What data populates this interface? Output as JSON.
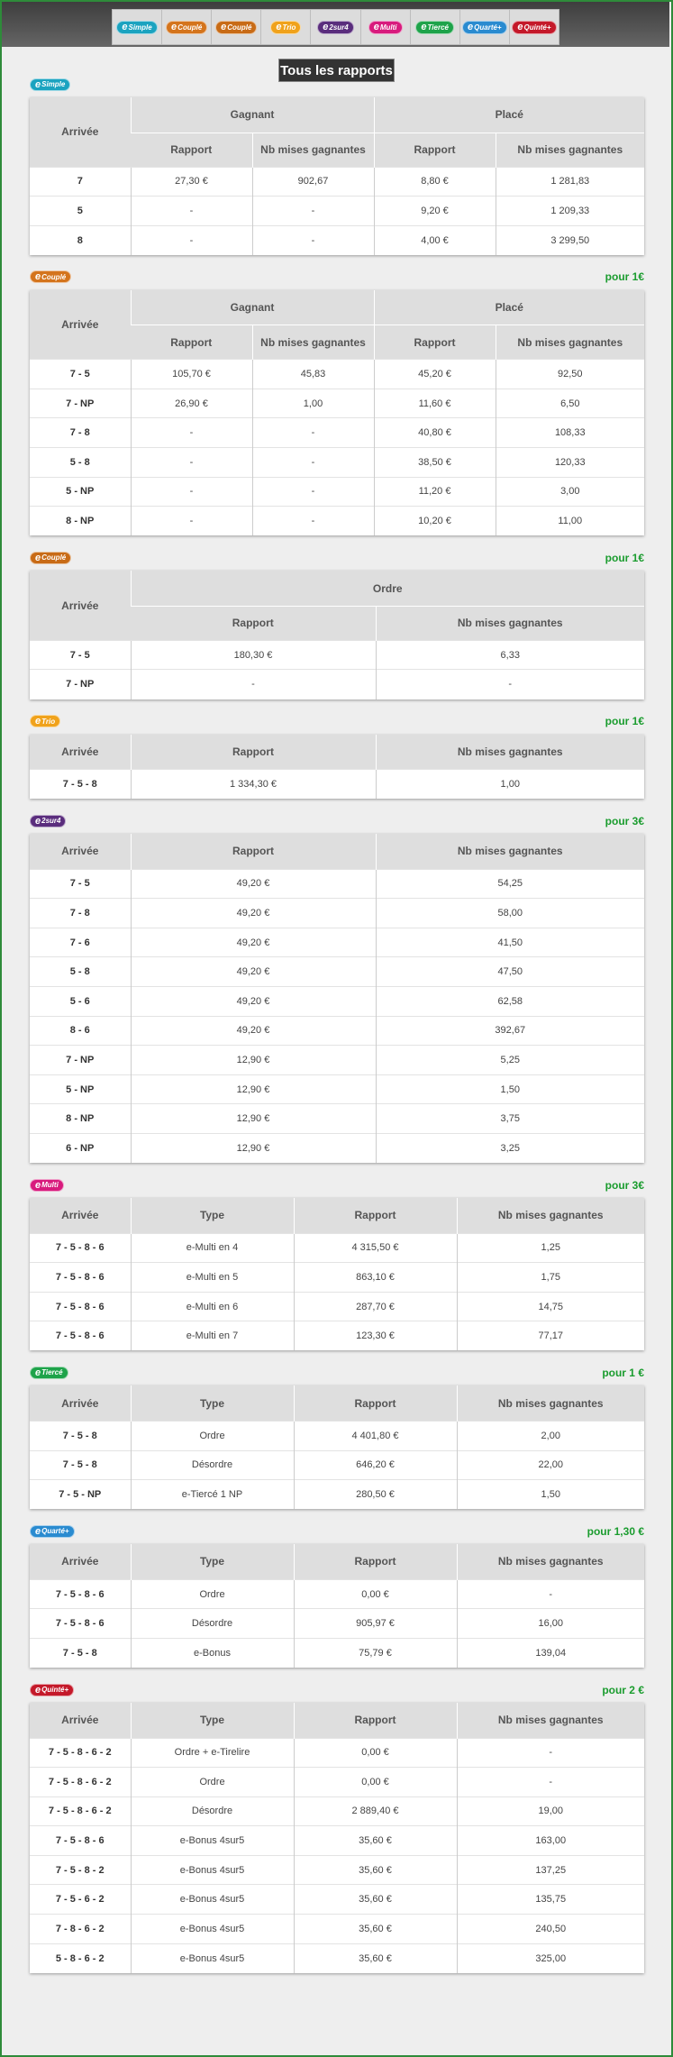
{
  "title": "Tous les rapports",
  "bet_types": [
    {
      "label": "Simple",
      "color": "#1ba3c0",
      "icon": "e-simple-logo"
    },
    {
      "label": "Couplé",
      "color": "#d4741c",
      "icon": "e-couple-logo"
    },
    {
      "label": "Couplé",
      "color": "#c86b16",
      "icon": "e-couple-ordre-logo"
    },
    {
      "label": "Trio",
      "color": "#f0a21b",
      "icon": "e-trio-logo"
    },
    {
      "label": "2sur4",
      "color": "#5a2d7d",
      "icon": "e-2sur4-logo"
    },
    {
      "label": "Multi",
      "color": "#d81b7d",
      "icon": "e-multi-logo"
    },
    {
      "label": "Tiercé",
      "color": "#1ea34a",
      "icon": "e-tierce-logo"
    },
    {
      "label": "Quarté+",
      "color": "#2a8bd0",
      "icon": "e-quarte-logo"
    },
    {
      "label": "Quinté+",
      "color": "#c4192a",
      "icon": "e-quinte-logo"
    }
  ],
  "sections": [
    {
      "bet": "Simple",
      "color": "#1ba3c0",
      "unit": "",
      "layout": "grouped",
      "groups": [
        "Gagnant",
        "Placé"
      ],
      "headers": [
        "Arrivée",
        "Rapport",
        "Nb mises gagnantes",
        "Rapport",
        "Nb mises gagnantes"
      ],
      "rows": [
        [
          "7",
          "27,30 €",
          "902,67",
          "8,80 €",
          "1 281,83"
        ],
        [
          "5",
          "-",
          "-",
          "9,20 €",
          "1 209,33"
        ],
        [
          "8",
          "-",
          "-",
          "4,00 €",
          "3 299,50"
        ]
      ]
    },
    {
      "bet": "Couplé",
      "color": "#d4741c",
      "unit": "pour 1€",
      "layout": "grouped",
      "groups": [
        "Gagnant",
        "Placé"
      ],
      "headers": [
        "Arrivée",
        "Rapport",
        "Nb mises gagnantes",
        "Rapport",
        "Nb mises gagnantes"
      ],
      "rows": [
        [
          "7 - 5",
          "105,70 €",
          "45,83",
          "45,20 €",
          "92,50"
        ],
        [
          "7 - NP",
          "26,90 €",
          "1,00",
          "11,60 €",
          "6,50"
        ],
        [
          "7 - 8",
          "-",
          "-",
          "40,80 €",
          "108,33"
        ],
        [
          "5 - 8",
          "-",
          "-",
          "38,50 €",
          "120,33"
        ],
        [
          "5 - NP",
          "-",
          "-",
          "11,20 €",
          "3,00"
        ],
        [
          "8 - NP",
          "-",
          "-",
          "10,20 €",
          "11,00"
        ]
      ]
    },
    {
      "bet": "Couplé",
      "color": "#c86b16",
      "unit": "pour 1€",
      "layout": "grouped",
      "groups": [
        "Ordre"
      ],
      "headers": [
        "Arrivée",
        "Rapport",
        "Nb mises gagnantes"
      ],
      "rows": [
        [
          "7 - 5",
          "180,30 €",
          "6,33"
        ],
        [
          "7 - NP",
          "-",
          "-"
        ]
      ]
    },
    {
      "bet": "Trio",
      "color": "#f0a21b",
      "unit": "pour 1€",
      "layout": "simple",
      "headers": [
        "Arrivée",
        "Rapport",
        "Nb mises gagnantes"
      ],
      "rows": [
        [
          "7 - 5 - 8",
          "1 334,30 €",
          "1,00"
        ]
      ]
    },
    {
      "bet": "2sur4",
      "color": "#5a2d7d",
      "unit": "pour 3€",
      "layout": "simple",
      "headers": [
        "Arrivée",
        "Rapport",
        "Nb mises gagnantes"
      ],
      "rows": [
        [
          "7 - 5",
          "49,20 €",
          "54,25"
        ],
        [
          "7 - 8",
          "49,20 €",
          "58,00"
        ],
        [
          "7 - 6",
          "49,20 €",
          "41,50"
        ],
        [
          "5 - 8",
          "49,20 €",
          "47,50"
        ],
        [
          "5 - 6",
          "49,20 €",
          "62,58"
        ],
        [
          "8 - 6",
          "49,20 €",
          "392,67"
        ],
        [
          "7 - NP",
          "12,90 €",
          "5,25"
        ],
        [
          "5 - NP",
          "12,90 €",
          "1,50"
        ],
        [
          "8 - NP",
          "12,90 €",
          "3,75"
        ],
        [
          "6 - NP",
          "12,90 €",
          "3,25"
        ]
      ]
    },
    {
      "bet": "Multi",
      "color": "#d81b7d",
      "unit": "pour 3€",
      "layout": "simple",
      "headers": [
        "Arrivée",
        "Type",
        "Rapport",
        "Nb mises gagnantes"
      ],
      "rows": [
        [
          "7 - 5 - 8 - 6",
          "e-Multi en 4",
          "4 315,50 €",
          "1,25"
        ],
        [
          "7 - 5 - 8 - 6",
          "e-Multi en 5",
          "863,10 €",
          "1,75"
        ],
        [
          "7 - 5 - 8 - 6",
          "e-Multi en 6",
          "287,70 €",
          "14,75"
        ],
        [
          "7 - 5 - 8 - 6",
          "e-Multi en 7",
          "123,30 €",
          "77,17"
        ]
      ]
    },
    {
      "bet": "Tiercé",
      "color": "#1ea34a",
      "unit": "pour 1 €",
      "layout": "simple",
      "headers": [
        "Arrivée",
        "Type",
        "Rapport",
        "Nb mises gagnantes"
      ],
      "rows": [
        [
          "7 - 5 - 8",
          "Ordre",
          "4 401,80 €",
          "2,00"
        ],
        [
          "7 - 5 - 8",
          "Désordre",
          "646,20 €",
          "22,00"
        ],
        [
          "7 - 5 - NP",
          "e-Tiercé 1 NP",
          "280,50 €",
          "1,50"
        ]
      ]
    },
    {
      "bet": "Quarté+",
      "color": "#2a8bd0",
      "unit": "pour 1,30 €",
      "layout": "simple",
      "headers": [
        "Arrivée",
        "Type",
        "Rapport",
        "Nb mises gagnantes"
      ],
      "rows": [
        [
          "7 - 5 - 8 - 6",
          "Ordre",
          "0,00 €",
          "-"
        ],
        [
          "7 - 5 - 8 - 6",
          "Désordre",
          "905,97 €",
          "16,00"
        ],
        [
          "7 - 5 - 8",
          "e-Bonus",
          "75,79 €",
          "139,04"
        ]
      ]
    },
    {
      "bet": "Quinté+",
      "color": "#c4192a",
      "unit": "pour 2 €",
      "layout": "simple",
      "headers": [
        "Arrivée",
        "Type",
        "Rapport",
        "Nb mises gagnantes"
      ],
      "rows": [
        [
          "7 - 5 - 8 - 6 - 2",
          "Ordre + e-Tirelire",
          "0,00 €",
          "-"
        ],
        [
          "7 - 5 - 8 - 6 - 2",
          "Ordre",
          "0,00 €",
          "-"
        ],
        [
          "7 - 5 - 8 - 6 - 2",
          "Désordre",
          "2 889,40 €",
          "19,00"
        ],
        [
          "7 - 5 - 8 - 6",
          "e-Bonus 4sur5",
          "35,60 €",
          "163,00"
        ],
        [
          "7 - 5 - 8 - 2",
          "e-Bonus 4sur5",
          "35,60 €",
          "137,25"
        ],
        [
          "7 - 5 - 6 - 2",
          "e-Bonus 4sur5",
          "35,60 €",
          "135,75"
        ],
        [
          "7 - 8 - 6 - 2",
          "e-Bonus 4sur5",
          "35,60 €",
          "240,50"
        ],
        [
          "5 - 8 - 6 - 2",
          "e-Bonus 4sur5",
          "35,60 €",
          "325,00"
        ]
      ]
    }
  ]
}
